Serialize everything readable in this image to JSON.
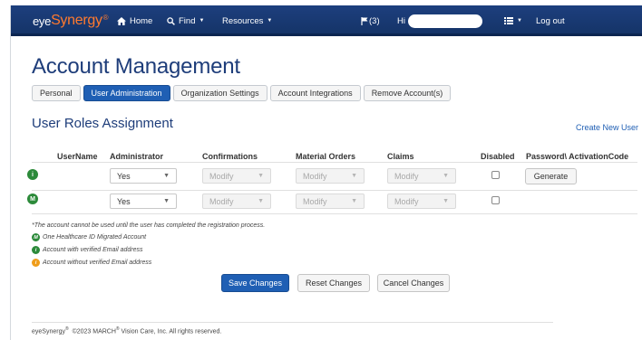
{
  "brand": {
    "prefix": "eye",
    "name": "Synergy",
    "mark": "®"
  },
  "nav": {
    "home": "Home",
    "find": "Find",
    "resources": "Resources",
    "messages": "(3)",
    "greeting": "Hi",
    "logout": "Log out"
  },
  "page": {
    "title": "Account Management"
  },
  "tabs": [
    {
      "label": "Personal",
      "active": false
    },
    {
      "label": "User Administration",
      "active": true
    },
    {
      "label": "Organization Settings",
      "active": false
    },
    {
      "label": "Account Integrations",
      "active": false
    },
    {
      "label": "Remove Account(s)",
      "active": false
    }
  ],
  "section": {
    "title": "User Roles Assignment",
    "create_link": "Create New User"
  },
  "table": {
    "headers": {
      "username": "UserName",
      "administrator": "Administrator",
      "confirmations": "Confirmations",
      "material_orders": "Material Orders",
      "claims": "Claims",
      "disabled": "Disabled",
      "password": "Password\\ ActivationCode"
    },
    "rows": [
      {
        "status_letter": "i",
        "administrator": "Yes",
        "confirmations": "Modify",
        "material_orders": "Modify",
        "claims": "Modify",
        "disabled": false,
        "generate": "Generate"
      },
      {
        "status_letter": "M",
        "administrator": "Yes",
        "confirmations": "Modify",
        "material_orders": "Modify",
        "claims": "Modify",
        "disabled": false
      }
    ]
  },
  "notes": {
    "registration": "*The account cannot be used until the user has completed the registration process.",
    "legend": [
      {
        "letter": "M",
        "text": "One Healthcare ID Migrated Account"
      },
      {
        "letter": "i",
        "text": "Account with verified Email address"
      },
      {
        "letter": "i",
        "text": "Account without verified Email address"
      }
    ]
  },
  "actions": {
    "save": "Save Changes",
    "reset": "Reset Changes",
    "cancel": "Cancel Changes"
  },
  "footer": {
    "brand_prefix": "eye",
    "brand_name": "Synergy",
    "mark": "®",
    "text_a": "©2023 MARCH",
    "text_b": "Vision Care, Inc. All rights reserved."
  },
  "colors": {
    "navbar": "#1d3f7e",
    "brand_orange": "#ff7a2e",
    "primary_button": "#1f5fb4",
    "heading": "#1e3d7a",
    "status_green": "#2c8a3a",
    "status_orange": "#ef9d1a"
  },
  "icons": {
    "home": "home-icon",
    "find": "search-icon",
    "messages": "flag-icon",
    "menu": "list-icon",
    "status": "status-icon"
  }
}
